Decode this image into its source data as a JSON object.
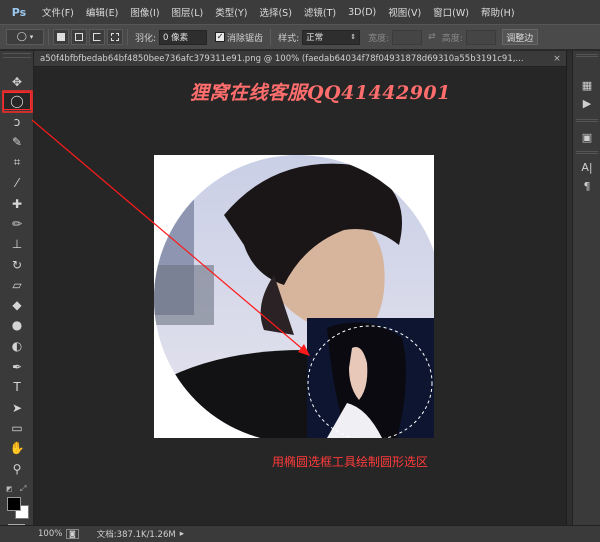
{
  "app": {
    "logo": "Ps"
  },
  "menu": {
    "items": [
      "文件(F)",
      "编辑(E)",
      "图像(I)",
      "图层(L)",
      "类型(Y)",
      "选择(S)",
      "滤镜(T)",
      "3D(D)",
      "视图(V)",
      "窗口(W)",
      "帮助(H)"
    ]
  },
  "options": {
    "feather_label": "羽化:",
    "feather_value": "0 像素",
    "antialias_label": "消除锯齿",
    "antialias_checked": true,
    "style_label": "样式:",
    "style_value": "正常",
    "width_label": "宽度:",
    "height_label": "高度:",
    "refine_edge_label": "调整边"
  },
  "document": {
    "tab_title": "a50f4bfbfbedab64bf4850bee736afc379311e91.png @ 100% (faedab64034f78f04931878d69310a55b3191c91,...",
    "close_glyph": "×"
  },
  "overlay": {
    "watermark": "狸窝在线客服QQ41442901",
    "caption": "用椭圆选框工具绘制圆形选区",
    "arrow_color": "#ff1a1a",
    "highlight_color": "#ff2a2a"
  },
  "tools": [
    {
      "name": "move-tool",
      "glyph": "✥"
    },
    {
      "name": "elliptical-marquee-tool",
      "glyph": "◯",
      "selected": true
    },
    {
      "name": "lasso-tool",
      "glyph": "ↄ"
    },
    {
      "name": "quick-selection-tool",
      "glyph": "✎"
    },
    {
      "name": "crop-tool",
      "glyph": "⌗"
    },
    {
      "name": "eyedropper-tool",
      "glyph": "⁄"
    },
    {
      "name": "spot-healing-tool",
      "glyph": "✚"
    },
    {
      "name": "brush-tool",
      "glyph": "✏"
    },
    {
      "name": "clone-stamp-tool",
      "glyph": "⊥"
    },
    {
      "name": "history-brush-tool",
      "glyph": "↻"
    },
    {
      "name": "eraser-tool",
      "glyph": "▱"
    },
    {
      "name": "paint-bucket-tool",
      "glyph": "◆"
    },
    {
      "name": "blur-tool",
      "glyph": "●"
    },
    {
      "name": "dodge-tool",
      "glyph": "◐"
    },
    {
      "name": "pen-tool",
      "glyph": "✒"
    },
    {
      "name": "type-tool",
      "glyph": "T"
    },
    {
      "name": "path-selection-tool",
      "glyph": "➤"
    },
    {
      "name": "rectangle-tool",
      "glyph": "▭"
    },
    {
      "name": "hand-tool",
      "glyph": "✋"
    },
    {
      "name": "zoom-tool",
      "glyph": "⚲"
    }
  ],
  "colors": {
    "foreground": "#000000",
    "background": "#ffffff"
  },
  "status": {
    "zoom": "100%",
    "doc_info": "文档:387.1K/1.26M"
  }
}
